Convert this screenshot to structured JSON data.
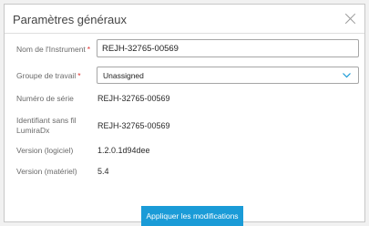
{
  "dialog": {
    "title": "Paramètres généraux",
    "close_icon": "close-icon"
  },
  "fields": {
    "instrument_name": {
      "label": "Nom de l'Instrument",
      "required_mark": "*",
      "value": "REJH-32765-00569"
    },
    "work_group": {
      "label": "Groupe de travail",
      "required_mark": "*",
      "selected": "Unassigned",
      "chevron_icon": "chevron-down-icon",
      "chevron_color": "#1a9bd7"
    },
    "serial_number": {
      "label": "Numéro de série",
      "value": "REJH-32765-00569"
    },
    "wireless_id": {
      "label_line1": "Identifiant sans fil",
      "label_line2": "LumiraDx",
      "value": "REJH-32765-00569"
    },
    "software_version": {
      "label": "Version (logiciel)",
      "value": "1.2.0.1d94dee"
    },
    "hardware_version": {
      "label": "Version (matériel)",
      "value": "5.4"
    }
  },
  "actions": {
    "apply_label": "Appliquer les modifications",
    "apply_color": "#1a9bd7"
  },
  "colors": {
    "required": "#e0312f",
    "accent": "#1a9bd7"
  }
}
